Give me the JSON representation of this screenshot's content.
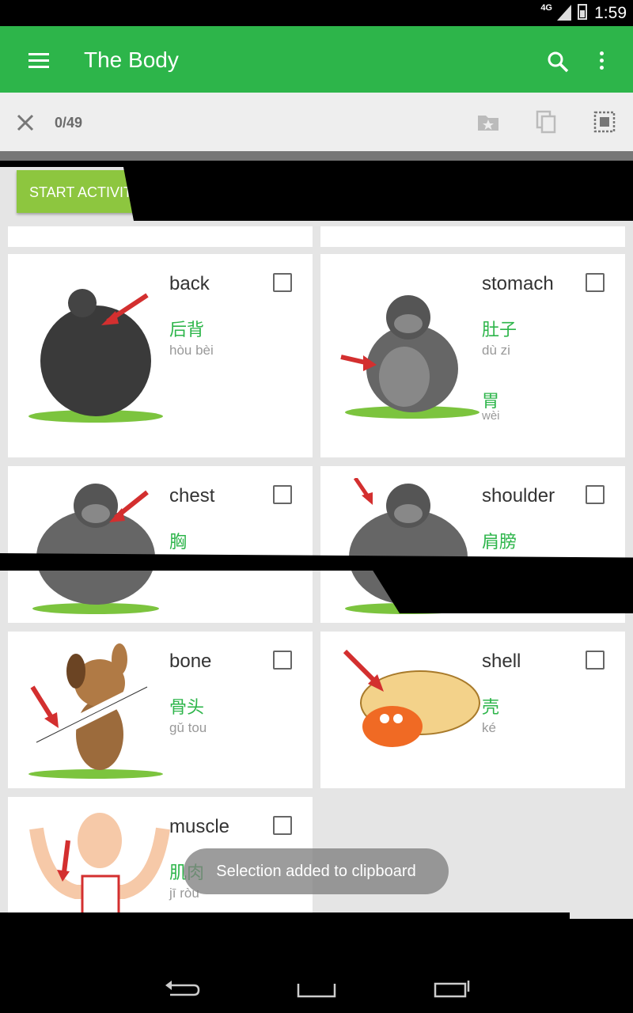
{
  "status_bar": {
    "network": "4G",
    "time": "1:59"
  },
  "app_bar": {
    "title": "The Body",
    "menu_icon": "hamburger-menu-icon",
    "search_icon": "search-icon",
    "overflow_icon": "overflow-menu-icon"
  },
  "selection_bar": {
    "count": "0/49",
    "close_icon": "close-icon",
    "folder_icon": "folder-star-icon",
    "copy_icon": "copy-icon",
    "select_all_icon": "select-all-icon"
  },
  "start_button": {
    "label": "START ACTIVITY"
  },
  "cards": [
    {
      "english": "back",
      "chinese": "后背",
      "pinyin": "hòu bèi",
      "checked": false
    },
    {
      "english": "stomach",
      "chinese": "肚子",
      "pinyin": "dù zi",
      "alt_chinese": "胃",
      "alt_pinyin": "wèi",
      "checked": false
    },
    {
      "english": "chest",
      "chinese": "胸",
      "checked": false
    },
    {
      "english": "shoulder",
      "chinese": "肩膀",
      "checked": false
    },
    {
      "english": "bone",
      "chinese": "骨头",
      "pinyin": "gǔ tou",
      "checked": false
    },
    {
      "english": "shell",
      "chinese": "壳",
      "pinyin": "ké",
      "checked": false
    },
    {
      "english": "muscle",
      "chinese": "肌肉",
      "pinyin": "jī ròu",
      "checked": false
    }
  ],
  "toast": "Selection added to clipboard",
  "colors": {
    "primary": "#2db54a",
    "accent": "#8dc63f",
    "arrow": "#d32f2f"
  }
}
